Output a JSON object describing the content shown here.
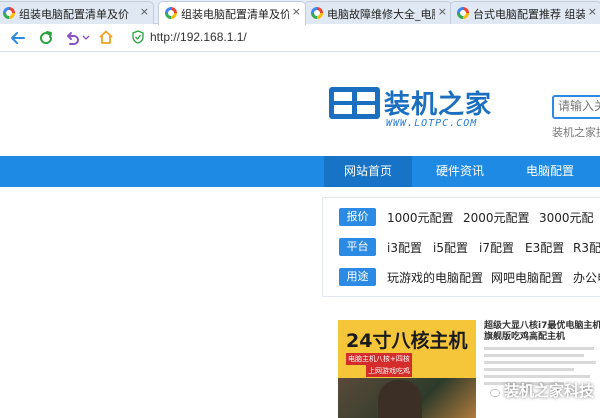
{
  "browser": {
    "tabs": [
      {
        "label": "组装电脑配置清单及价",
        "close": "×",
        "active": false
      },
      {
        "label": "组装电脑配置清单及价",
        "close": "×",
        "active": true
      },
      {
        "label": "电脑故障维修大全_电脑",
        "close": "×",
        "active": false
      },
      {
        "label": "台式电脑配置推荐 组装",
        "close": "×",
        "active": false
      }
    ],
    "nav_icons": [
      "back-arrow-icon",
      "refresh-icon",
      "undo-icon",
      "home-icon"
    ],
    "address": "http://192.168.1.1/",
    "colors": {
      "nav_blue": "#1f8ae4",
      "icon_green": "#2aa33f",
      "icon_purple": "#8a52c8",
      "home_orange": "#f0a020"
    }
  },
  "site": {
    "logo_text": "装机之家",
    "logo_url": "WWW.LOTPC.COM",
    "search_placeholder": "请输入关",
    "search_hint": "装机之家提",
    "nav": [
      "网站首页",
      "硬件资讯",
      "电脑配置"
    ],
    "filters": [
      {
        "tag": "报价",
        "options": [
          "1000元配置",
          "2000元配置",
          "3000元配"
        ]
      },
      {
        "tag": "平台",
        "options": [
          "i3配置",
          "i5配置",
          "i7配置",
          "E3配置",
          "R3配"
        ]
      },
      {
        "tag": "用途",
        "options": [
          "玩游戏的电脑配置",
          "网吧电脑配置",
          "办公电"
        ]
      }
    ],
    "ad": {
      "banner_title": "24寸八核主机",
      "banner_sub1": "电脑主机八核+四核",
      "banner_sub2": "上网游戏吃鸡",
      "article_title": "超级大显八核i7最优电脑主机旗舰版吃鸡高配主机"
    },
    "watermark": "装机之家科技"
  }
}
